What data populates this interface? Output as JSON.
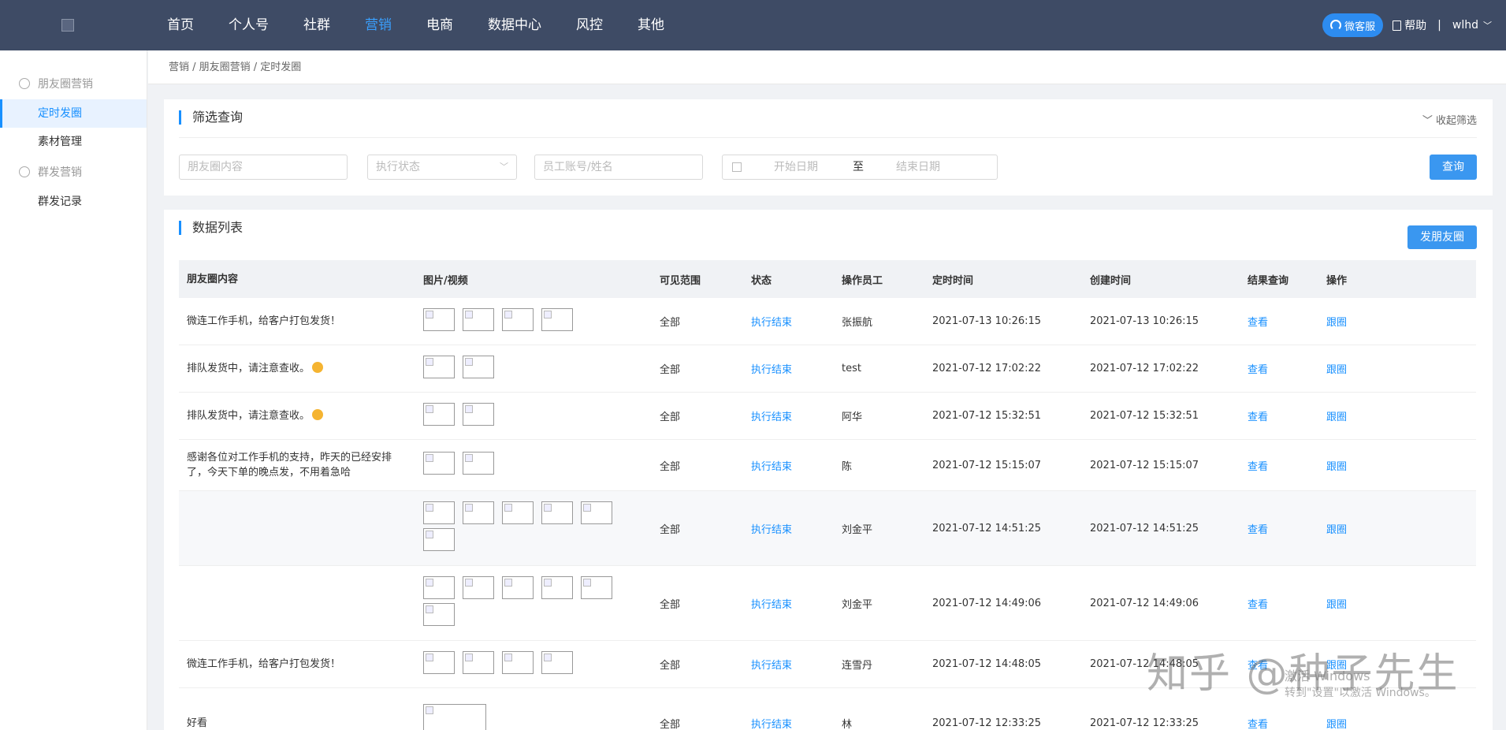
{
  "nav": {
    "items": [
      {
        "label": "首页",
        "active": false
      },
      {
        "label": "个人号",
        "active": false
      },
      {
        "label": "社群",
        "active": false
      },
      {
        "label": "营销",
        "active": true
      },
      {
        "label": "电商",
        "active": false
      },
      {
        "label": "数据中心",
        "active": false
      },
      {
        "label": "风控",
        "active": false
      },
      {
        "label": "其他",
        "active": false
      }
    ],
    "kefu": "微客服",
    "help": "帮助",
    "separator": "|",
    "user": "wlhd",
    "accent": "#3aa0ff"
  },
  "sidebar": {
    "group1": "朋友圈营销",
    "group1_items": [
      "定时发圈",
      "素材管理"
    ],
    "group2": "群发营销",
    "group2_items": [
      "群发记录"
    ]
  },
  "breadcrumb": "营销 / 朋友圈营销 / 定时发圈",
  "filter": {
    "title": "筛选查询",
    "collapse": "收起筛选",
    "content_placeholder": "朋友圈内容",
    "status_placeholder": "执行状态",
    "employee_placeholder": "员工账号/姓名",
    "start_date": "开始日期",
    "to": "至",
    "end_date": "结束日期",
    "query_button": "查询"
  },
  "list": {
    "title": "数据列表",
    "post_button": "发朋友圈",
    "columns": [
      "朋友圈内容",
      "图片/视频",
      "可见范围",
      "状态",
      "操作员工",
      "定时时间",
      "创建时间",
      "结果查询",
      "操作"
    ],
    "rows": [
      {
        "content": "微连工作手机，给客户打包发货！",
        "images": 4,
        "scope": "全部",
        "status": "执行结束",
        "employee": "张振航",
        "scheduled": "2021-07-13 10:26:15",
        "created": "2021-07-13 10:26:15",
        "view": "查看",
        "action": "跟圈"
      },
      {
        "content": "排队发货中，请注意查收。",
        "emoji": true,
        "images": 2,
        "scope": "全部",
        "status": "执行结束",
        "employee": "test",
        "scheduled": "2021-07-12 17:02:22",
        "created": "2021-07-12 17:02:22",
        "view": "查看",
        "action": "跟圈"
      },
      {
        "content": "排队发货中，请注意查收。",
        "emoji": true,
        "images": 2,
        "scope": "全部",
        "status": "执行结束",
        "employee": "阿华",
        "scheduled": "2021-07-12 15:32:51",
        "created": "2021-07-12 15:32:51",
        "view": "查看",
        "action": "跟圈"
      },
      {
        "content": "感谢各位对工作手机的支持，昨天的已经安排了，今天下单的晚点发，不用着急哈",
        "images": 2,
        "scope": "全部",
        "status": "执行结束",
        "employee": "陈",
        "scheduled": "2021-07-12 15:15:07",
        "created": "2021-07-12 15:15:07",
        "view": "查看",
        "action": "跟圈"
      },
      {
        "content": "",
        "images": 6,
        "scope": "全部",
        "status": "执行结束",
        "employee": "刘金平",
        "scheduled": "2021-07-12 14:51:25",
        "created": "2021-07-12 14:51:25",
        "view": "查看",
        "action": "跟圈",
        "highlight": true
      },
      {
        "content": "",
        "images": 6,
        "scope": "全部",
        "status": "执行结束",
        "employee": "刘金平",
        "scheduled": "2021-07-12 14:49:06",
        "created": "2021-07-12 14:49:06",
        "view": "查看",
        "action": "跟圈"
      },
      {
        "content": "微连工作手机，给客户打包发货！",
        "images": 4,
        "scope": "全部",
        "status": "执行结束",
        "employee": "连雪丹",
        "scheduled": "2021-07-12 14:48:05",
        "created": "2021-07-12 14:48:05",
        "view": "查看",
        "action": "跟圈"
      },
      {
        "content": "好看",
        "images": 1,
        "big_image": true,
        "scope": "全部",
        "status": "执行结束",
        "employee": "林",
        "scheduled": "2021-07-12 12:33:25",
        "created": "2021-07-12 12:33:25",
        "view": "查看",
        "action": "跟圈"
      }
    ]
  },
  "watermark": "知乎 @种子先生",
  "windows_notice": [
    "激活 Windows",
    "转到\"设置\"以激活 Windows。"
  ]
}
